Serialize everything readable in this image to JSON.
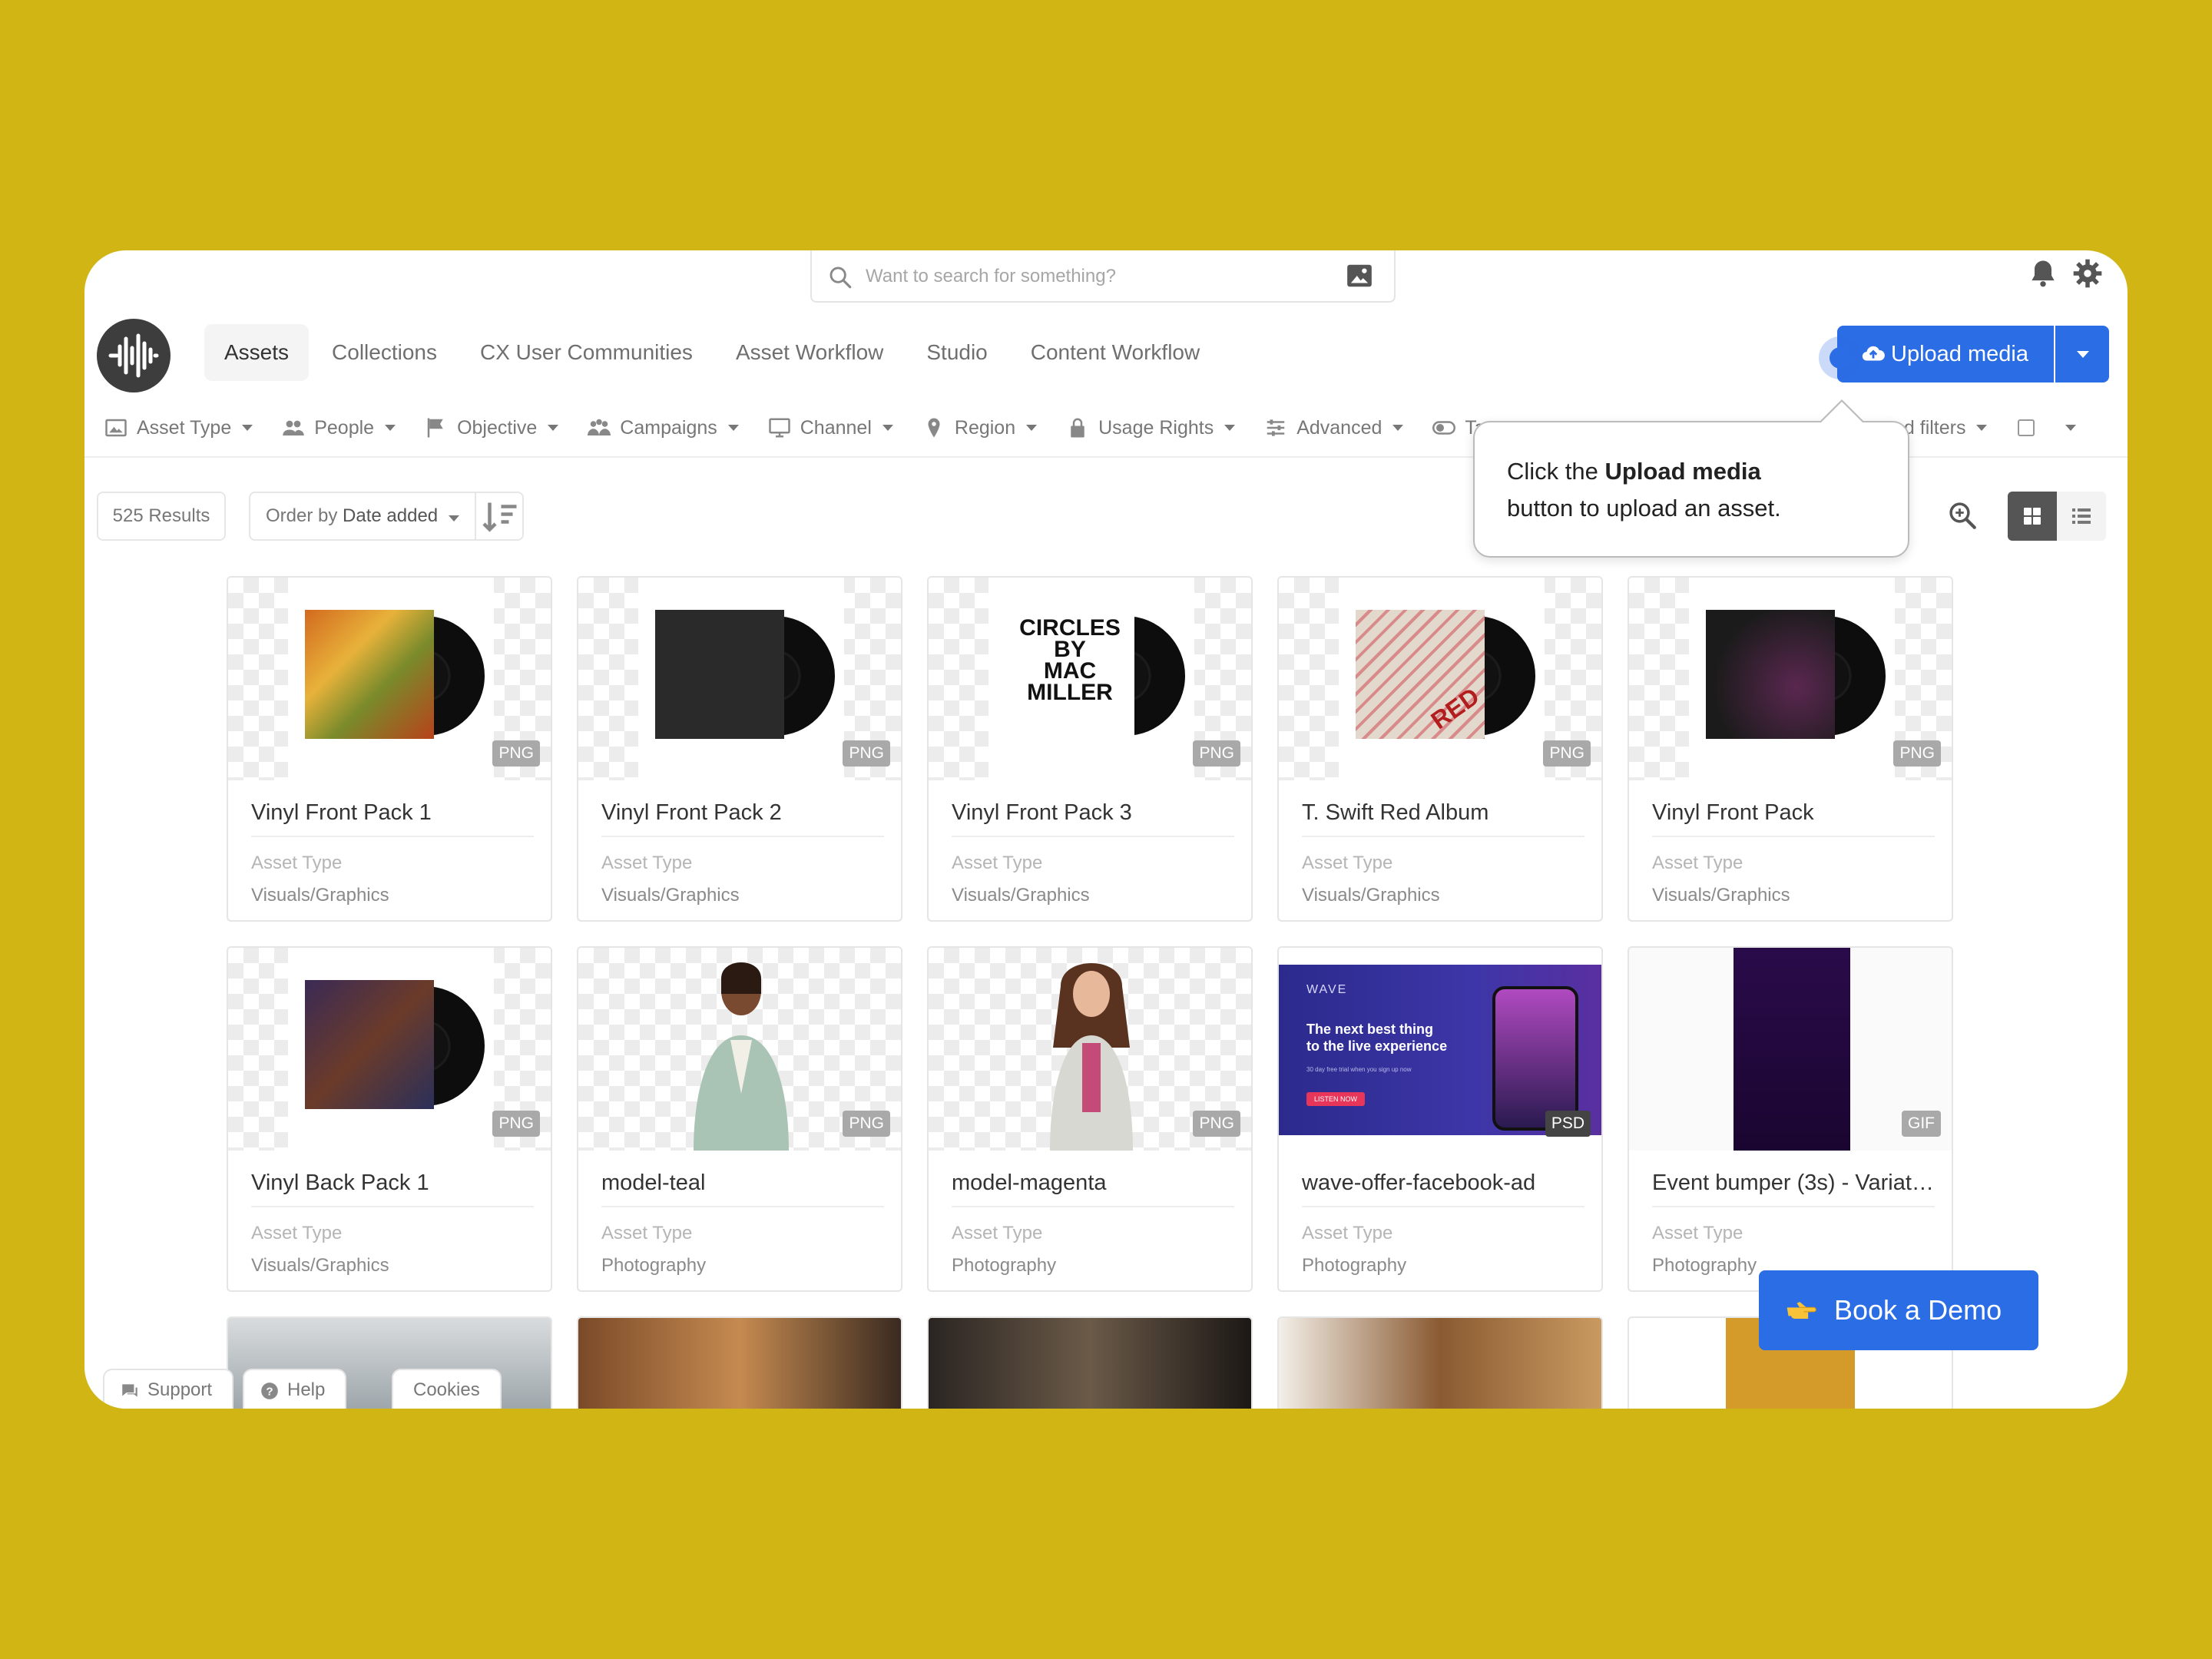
{
  "search": {
    "placeholder": "Want to search for something?"
  },
  "nav": {
    "items": [
      {
        "label": "Assets",
        "active": true
      },
      {
        "label": "Collections"
      },
      {
        "label": "CX User Communities"
      },
      {
        "label": "Asset Workflow"
      },
      {
        "label": "Studio"
      },
      {
        "label": "Content Workflow"
      }
    ]
  },
  "upload": {
    "label": "Upload media"
  },
  "filters": [
    {
      "label": "Asset Type",
      "icon": "image-icon"
    },
    {
      "label": "People",
      "icon": "people-icon"
    },
    {
      "label": "Objective",
      "icon": "flag-icon"
    },
    {
      "label": "Campaigns",
      "icon": "campaigns-icon"
    },
    {
      "label": "Channel",
      "icon": "monitor-icon"
    },
    {
      "label": "Region",
      "icon": "location-pin-icon"
    },
    {
      "label": "Usage Rights",
      "icon": "lock-icon"
    },
    {
      "label": "Advanced",
      "icon": "sliders-icon"
    },
    {
      "label": "Tags",
      "icon": "toggle-icon"
    }
  ],
  "saved_filters": {
    "label": "…ed filters"
  },
  "toolbar": {
    "results": "525 Results",
    "order_prefix": "Order by",
    "order_value": "Date added"
  },
  "tooltip": {
    "before": "Click the",
    "bold": "Upload media",
    "after": "button to upload an asset."
  },
  "assets": [
    {
      "title": "Vinyl Front Pack 1",
      "format": "PNG",
      "meta_label": "Asset Type",
      "meta_value": "Visuals/Graphics",
      "art": "autumn"
    },
    {
      "title": "Vinyl Front Pack 2",
      "format": "PNG",
      "meta_label": "Asset Type",
      "meta_value": "Visuals/Graphics",
      "art": "dark"
    },
    {
      "title": "Vinyl Front Pack 3",
      "format": "PNG",
      "meta_label": "Asset Type",
      "meta_value": "Visuals/Graphics",
      "art": "circles",
      "cover_text": [
        "CIRCLES",
        "BY",
        "MAC",
        "MILLER"
      ]
    },
    {
      "title": "T. Swift Red Album",
      "format": "PNG",
      "meta_label": "Asset Type",
      "meta_value": "Visuals/Graphics",
      "art": "red",
      "cover_text": [
        "RED"
      ]
    },
    {
      "title": "Vinyl Front Pack",
      "format": "PNG",
      "meta_label": "Asset Type",
      "meta_value": "Visuals/Graphics",
      "art": "purple"
    },
    {
      "title": "Vinyl Back Pack 1",
      "format": "PNG",
      "meta_label": "Asset Type",
      "meta_value": "Visuals/Graphics",
      "art": "back"
    },
    {
      "title": "model-teal",
      "format": "PNG",
      "meta_label": "Asset Type",
      "meta_value": "Photography",
      "art": "model-teal"
    },
    {
      "title": "model-magenta",
      "format": "PNG",
      "meta_label": "Asset Type",
      "meta_value": "Photography",
      "art": "model-magenta"
    },
    {
      "title": "wave-offer-facebook-ad",
      "format": "PSD",
      "meta_label": "Asset Type",
      "meta_value": "Photography",
      "art": "wave",
      "ad": {
        "brand": "WAVE",
        "headline_1": "The next best thing",
        "headline_2": "to the live experience",
        "sub": "30 day free trial when you sign up now",
        "cta": "LISTEN NOW"
      }
    },
    {
      "title": "Event bumper (3s) - Variat…",
      "format": "GIF",
      "meta_label": "Asset Type",
      "meta_value": "Photography",
      "art": "bumper"
    }
  ],
  "bottom": {
    "support": "Support",
    "help": "Help",
    "cookies": "Cookies",
    "demo": "Book a Demo"
  },
  "colors": {
    "background": "#d1b515",
    "primary": "#2b6de4"
  }
}
